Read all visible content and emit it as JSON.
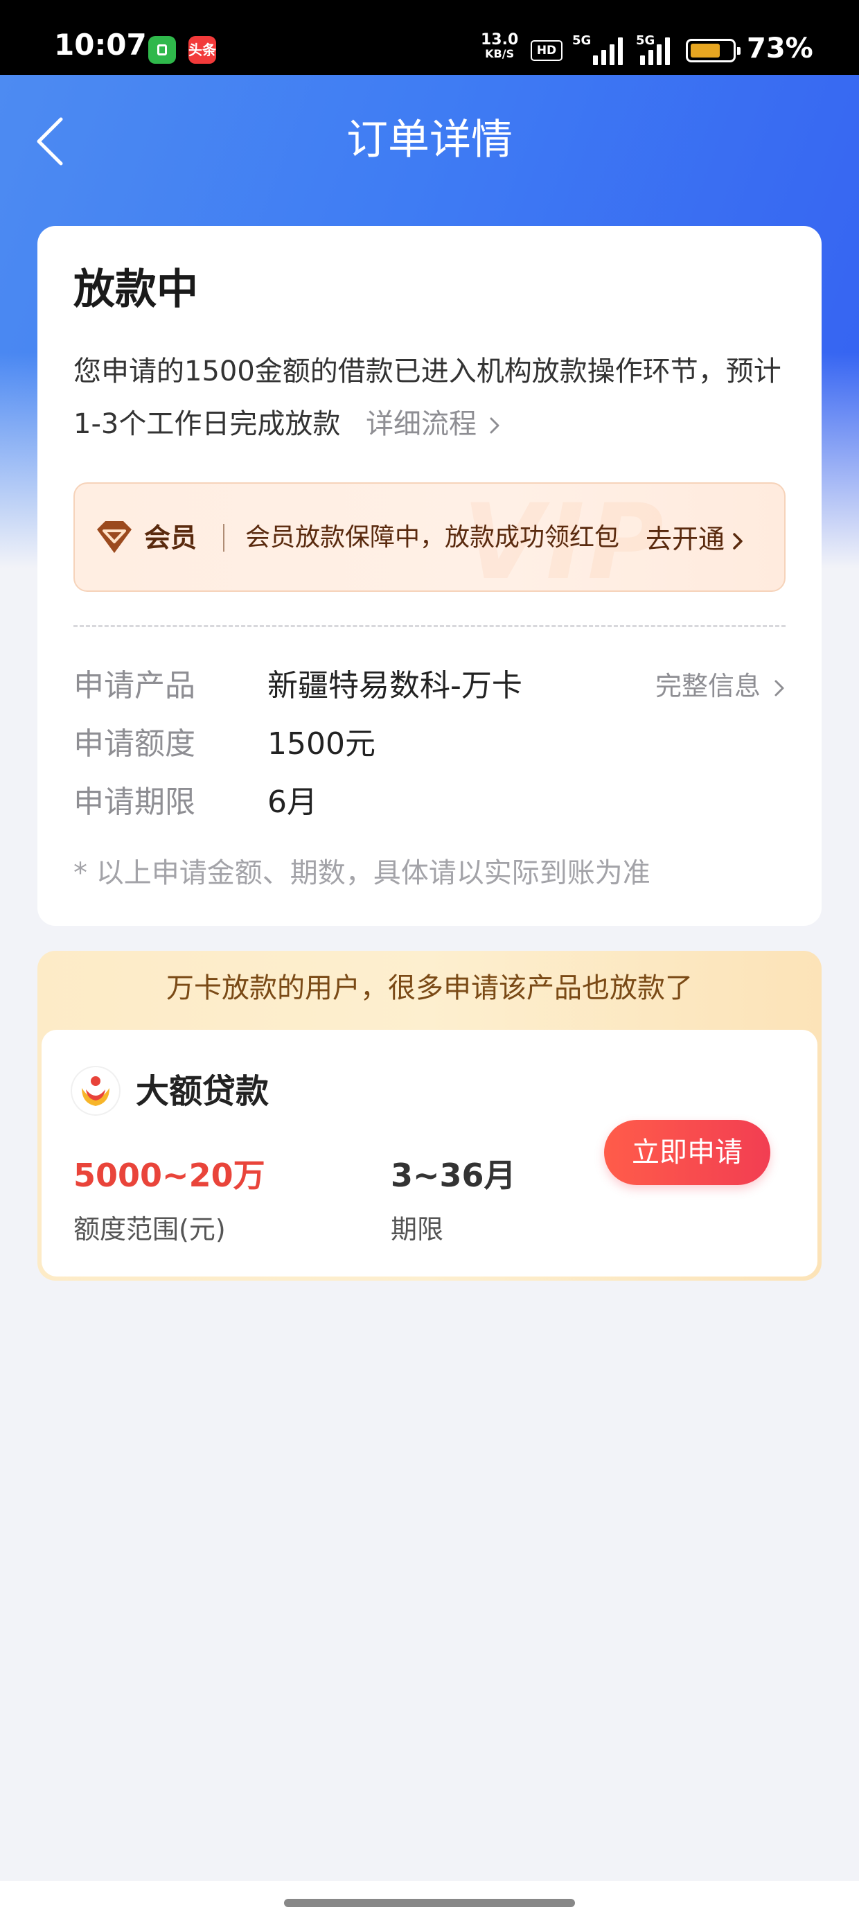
{
  "status_bar": {
    "time": "10:07",
    "app_badge_red": "头条",
    "net_speed_value": "13.0",
    "net_speed_unit": "KB/S",
    "hd_label": "HD",
    "signal_1_label": "5G",
    "signal_2_label": "5G",
    "battery_percent": "73%",
    "battery_level": 0.73,
    "icons": [
      "wechat-mini-app-icon",
      "toutiao-icon",
      "hd-icon",
      "signal-icon",
      "battery-icon"
    ]
  },
  "nav": {
    "title": "订单详情",
    "back_icon": "chevron-left-icon"
  },
  "order": {
    "status_title": "放款中",
    "description": "您申请的1500金额的借款已进入机构放款操作环节，预计1-3个工作日完成放款",
    "detail_link": "详细流程",
    "vip": {
      "label": "会员",
      "text": "会员放款保障中，放款成功领红包",
      "cta": "去开通",
      "watermark": "VIP"
    },
    "rows": [
      {
        "label": "申请产品",
        "value": "新疆特易数科-万卡",
        "more": "完整信息"
      },
      {
        "label": "申请额度",
        "value": "1500元"
      },
      {
        "label": "申请期限",
        "value": "6月"
      }
    ],
    "note": "* 以上申请金额、期数，具体请以实际到账为准"
  },
  "recommend": {
    "header": "万卡放款的用户，很多申请该产品也放款了",
    "product": {
      "name": "大额贷款",
      "amount": "5000~20万",
      "amount_label": "额度范围(元)",
      "term": "3~36月",
      "term_label": "期限",
      "apply_label": "立即申请"
    }
  },
  "colors": {
    "primary_blue": "#3F7CF3",
    "accent_red": "#E9443A",
    "vip_brown": "#5A2A0E"
  }
}
